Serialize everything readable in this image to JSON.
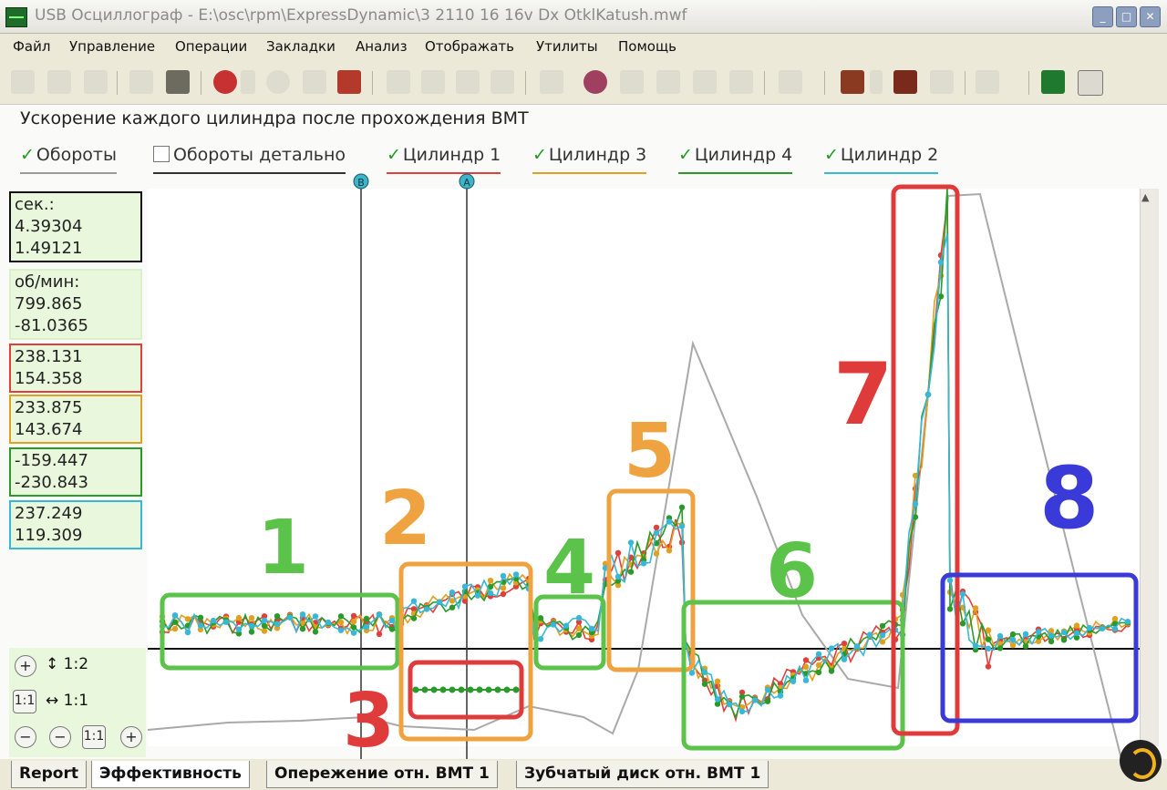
{
  "window": {
    "title": "USB Осциллограф - E:\\osc\\rpm\\ExpressDynamic\\3 2110 16 16v Dx OtklKatush.mwf"
  },
  "menu": [
    "Файл",
    "Управление",
    "Операции",
    "Закладки",
    "Анализ",
    "Отображать",
    "Утилиты",
    "Помощь"
  ],
  "chart": {
    "title": "Ускорение каждого цилиндра после прохождения ВМТ",
    "legend": [
      {
        "label": "Обороты",
        "checked": true,
        "color": "#9a9a9a"
      },
      {
        "label": "Обороты детально",
        "checked": false,
        "color": "#333333"
      },
      {
        "label": "Цилиндр 1",
        "checked": true,
        "color": "#e0403a"
      },
      {
        "label": "Цилиндр 3",
        "checked": true,
        "color": "#e0a020"
      },
      {
        "label": "Цилиндр 4",
        "checked": true,
        "color": "#2a9a2a"
      },
      {
        "label": "Цилиндр 2",
        "checked": true,
        "color": "#38b8d8"
      }
    ],
    "markers": [
      "B",
      "A"
    ],
    "annotations": [
      "1",
      "2",
      "3",
      "4",
      "5",
      "6",
      "7",
      "8"
    ]
  },
  "readouts": {
    "time": {
      "label": "сек.:",
      "v1": "4.39304",
      "v2": "1.49121",
      "border": "#111111"
    },
    "rpm": {
      "label": "об/мин:",
      "v1": "799.865",
      "v2": "-81.0365",
      "border": "#d9f0c9"
    },
    "cyl1": {
      "v1": "238.131",
      "v2": "154.358",
      "border": "#e0403a"
    },
    "cyl3": {
      "v1": "233.875",
      "v2": "143.674",
      "border": "#e0a020"
    },
    "cyl4": {
      "v1": "-159.447",
      "v2": "-230.843",
      "border": "#2a9a2a"
    },
    "cyl2": {
      "v1": "237.249",
      "v2": "119.309",
      "border": "#38b8d8"
    }
  },
  "scale": {
    "vertical": "1:2",
    "horizontal": "1:1",
    "reset": "1:1",
    "zoom_reset": "1:1"
  },
  "tabs": [
    "Report",
    "Эффективность",
    "Опережение отн. ВМТ 1",
    "Зубчатый диск отн. ВМТ 1"
  ]
}
